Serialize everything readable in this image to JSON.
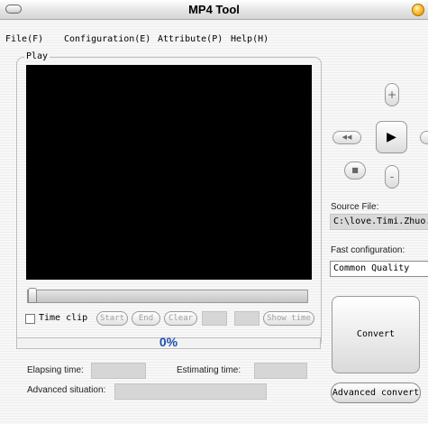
{
  "window": {
    "title": "MP4 Tool"
  },
  "menu": [
    "File(F)",
    "Configuration(E)",
    "Attribute(P)",
    "Help(H)"
  ],
  "play": {
    "group_label": "Play",
    "time_clip_label": "Time clip",
    "time_clip_checked": false,
    "buttons": {
      "start": "Start",
      "end": "End",
      "clear": "Clear",
      "show_time": "Show time"
    }
  },
  "progress": {
    "value": 0,
    "text": "0%"
  },
  "status": {
    "elapsing_label": "Elapsing time:",
    "estimating_label": "Estimating time:",
    "advanced_label": "Advanced situation:"
  },
  "controls": {
    "up": "+",
    "down": "-",
    "rewind": "◀◀",
    "play": "▶",
    "stop": "■"
  },
  "source": {
    "label": "Source File:",
    "value": "C:\\love.Timi.Zhuo."
  },
  "config": {
    "label": "Fast configuration:",
    "value": "Common Quality"
  },
  "actions": {
    "convert": "Convert",
    "advanced_convert": "Advanced convert"
  }
}
